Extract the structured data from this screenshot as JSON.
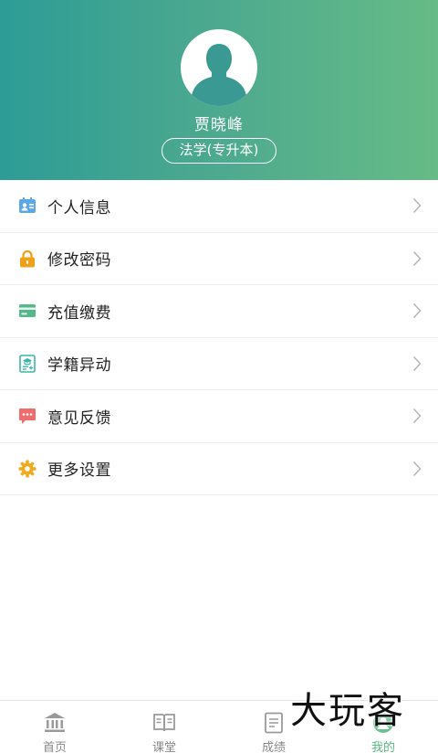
{
  "profile": {
    "name": "贾晓峰",
    "major": "法学(专升本)"
  },
  "menu": {
    "items": [
      {
        "label": "个人信息",
        "icon": "id-card-icon",
        "color": "#5aa9e6"
      },
      {
        "label": "修改密码",
        "icon": "lock-icon",
        "color": "#f0a11a"
      },
      {
        "label": "充值缴费",
        "icon": "card-icon",
        "color": "#55b88a"
      },
      {
        "label": "学籍异动",
        "icon": "student-record-icon",
        "color": "#3cb6a9"
      },
      {
        "label": "意见反馈",
        "icon": "chat-bubble-icon",
        "color": "#ef6d6d"
      },
      {
        "label": "更多设置",
        "icon": "gear-icon",
        "color": "#f1a91f"
      }
    ]
  },
  "tabbar": {
    "items": [
      {
        "label": "首页",
        "icon": "bank-icon"
      },
      {
        "label": "课堂",
        "icon": "book-icon"
      },
      {
        "label": "成绩",
        "icon": "report-icon"
      },
      {
        "label": "我的",
        "icon": "user-icon",
        "active": true
      }
    ]
  },
  "watermark": "大玩客",
  "colors": {
    "header_start": "#2d9c96",
    "header_end": "#66bb86",
    "active_tab": "#5bb884"
  }
}
